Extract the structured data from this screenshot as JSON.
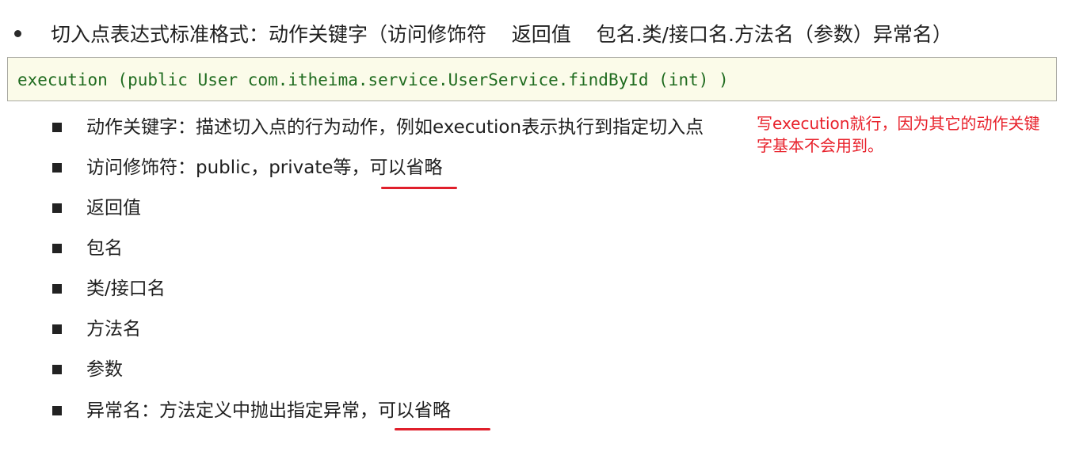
{
  "heading": {
    "text": "切入点表达式标准格式：动作关键字（访问修饰符    返回值    包名.类/接口名.方法名（参数）异常名）"
  },
  "code": {
    "text": "execution (public User com.itheima.service.UserService.findById (int) )"
  },
  "items": [
    {
      "prefix": "动作关键字：描述切入点的行为动作，例如execution表示执行到指定切入点",
      "highlight": ""
    },
    {
      "prefix": "访问修饰符：public，private等，",
      "highlight": "可以省略"
    },
    {
      "prefix": "返回值",
      "highlight": ""
    },
    {
      "prefix": "包名",
      "highlight": ""
    },
    {
      "prefix": "类/接口名",
      "highlight": ""
    },
    {
      "prefix": "方法名",
      "highlight": ""
    },
    {
      "prefix": "参数",
      "highlight": ""
    },
    {
      "prefix": "异常名：方法定义中抛出指定异常，",
      "highlight": "可以省略"
    }
  ],
  "annotation": {
    "text": "写execution就行，因为其它的动作关键字基本不会用到。"
  },
  "colors": {
    "annotation": "#e8212b",
    "underline": "#e01f2b",
    "code_text": "#1f6b1f",
    "code_background": "#fbfbe9"
  }
}
